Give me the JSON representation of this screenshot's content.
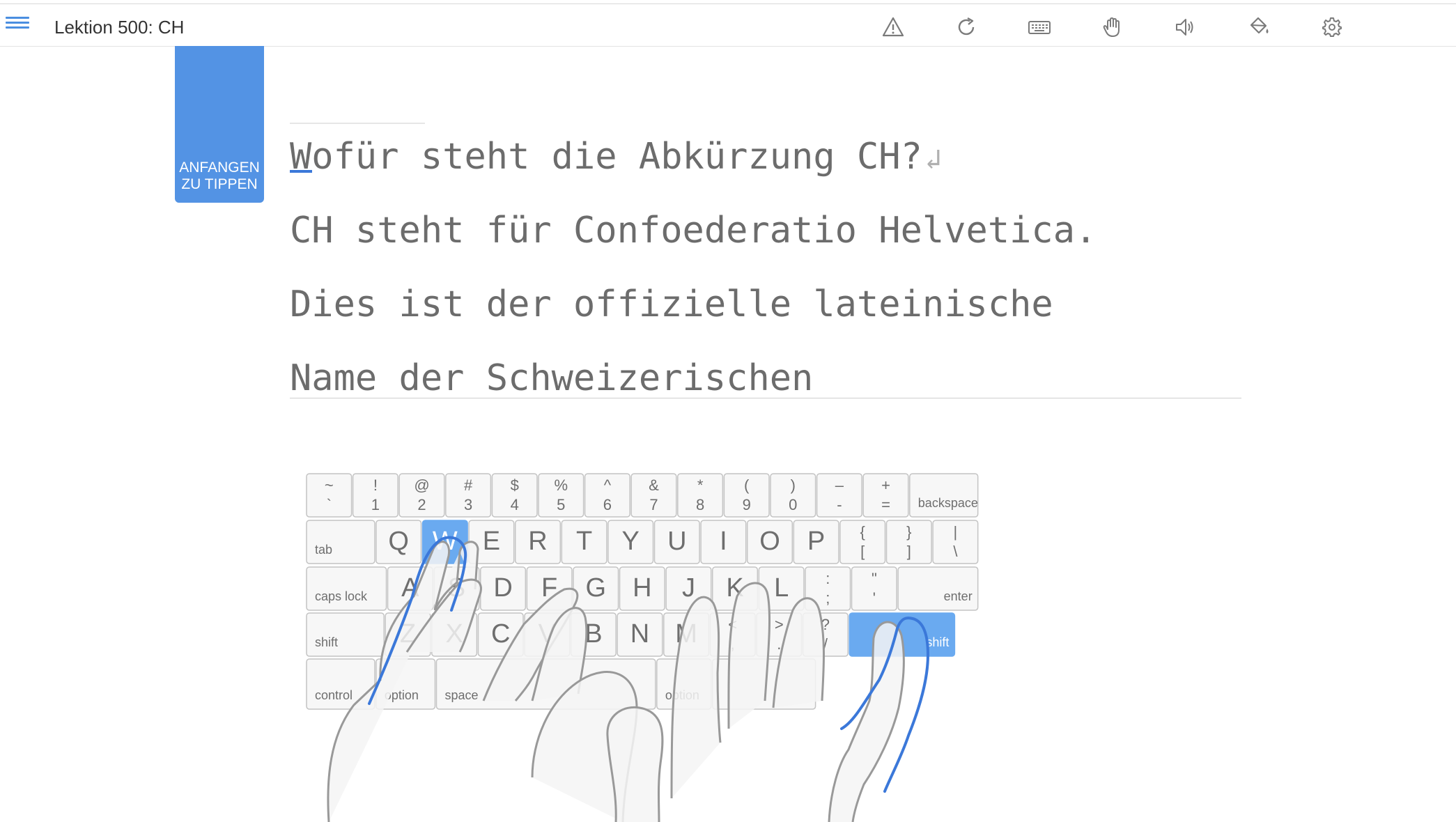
{
  "header": {
    "menu_icon": "hamburger-icon",
    "title": "Lektion 500: CH",
    "icons": [
      "warning-icon",
      "reload-icon",
      "keyboard-icon",
      "hand-icon",
      "sound-icon",
      "paint-bucket-icon",
      "gear-icon"
    ]
  },
  "start_button": {
    "line1": "ANFANGEN",
    "line2": "ZU TIPPEN"
  },
  "lesson": {
    "lines": [
      "Wofür steht die Abkürzung CH?",
      "CH steht für Confoederatio Helvetica.",
      "Dies ist der offizielle lateinische",
      "Name der Schweizerischen"
    ],
    "enter_symbol": "↲"
  },
  "keyboard": {
    "highlight_color": "#6aaaf0",
    "finger_color": "#3b78d9",
    "highlighted_keys": [
      "W",
      "shift-right"
    ],
    "rows": [
      [
        {
          "top": "~",
          "bottom": "`"
        },
        {
          "top": "!",
          "bottom": "1"
        },
        {
          "top": "@",
          "bottom": "2"
        },
        {
          "top": "#",
          "bottom": "3"
        },
        {
          "top": "$",
          "bottom": "4"
        },
        {
          "top": "%",
          "bottom": "5"
        },
        {
          "top": "^",
          "bottom": "6"
        },
        {
          "top": "&",
          "bottom": "7"
        },
        {
          "top": "*",
          "bottom": "8"
        },
        {
          "top": "(",
          "bottom": "9"
        },
        {
          "top": ")",
          "bottom": "0"
        },
        {
          "top": "–",
          "bottom": "-"
        },
        {
          "top": "+",
          "bottom": "="
        },
        {
          "label": "backspace"
        }
      ],
      [
        {
          "label": "tab"
        },
        {
          "main": "Q"
        },
        {
          "main": "W"
        },
        {
          "main": "E"
        },
        {
          "main": "R"
        },
        {
          "main": "T"
        },
        {
          "main": "Y"
        },
        {
          "main": "U"
        },
        {
          "main": "I"
        },
        {
          "main": "O"
        },
        {
          "main": "P"
        },
        {
          "top": "{",
          "bottom": "["
        },
        {
          "top": "}",
          "bottom": "]"
        },
        {
          "top": "|",
          "bottom": "\\"
        }
      ],
      [
        {
          "label": "caps lock"
        },
        {
          "main": "A"
        },
        {
          "main": "S"
        },
        {
          "main": "D"
        },
        {
          "main": "F"
        },
        {
          "main": "G"
        },
        {
          "main": "H"
        },
        {
          "main": "J"
        },
        {
          "main": "K"
        },
        {
          "main": "L"
        },
        {
          "top": ":",
          "bottom": ";"
        },
        {
          "top": "\"",
          "bottom": "'"
        },
        {
          "label": "enter"
        }
      ],
      [
        {
          "label": "shift"
        },
        {
          "main": "Z"
        },
        {
          "main": "X"
        },
        {
          "main": "C"
        },
        {
          "main": "V"
        },
        {
          "main": "B"
        },
        {
          "main": "N"
        },
        {
          "main": "M"
        },
        {
          "top": "<",
          "bottom": ","
        },
        {
          "top": ">",
          "bottom": "."
        },
        {
          "top": "?",
          "bottom": "/"
        },
        {
          "label": "shift"
        }
      ],
      [
        {
          "label": "control"
        },
        {
          "label": "option"
        },
        {
          "label": "space"
        },
        {
          "label": "option"
        },
        {
          "label": ""
        }
      ]
    ]
  }
}
